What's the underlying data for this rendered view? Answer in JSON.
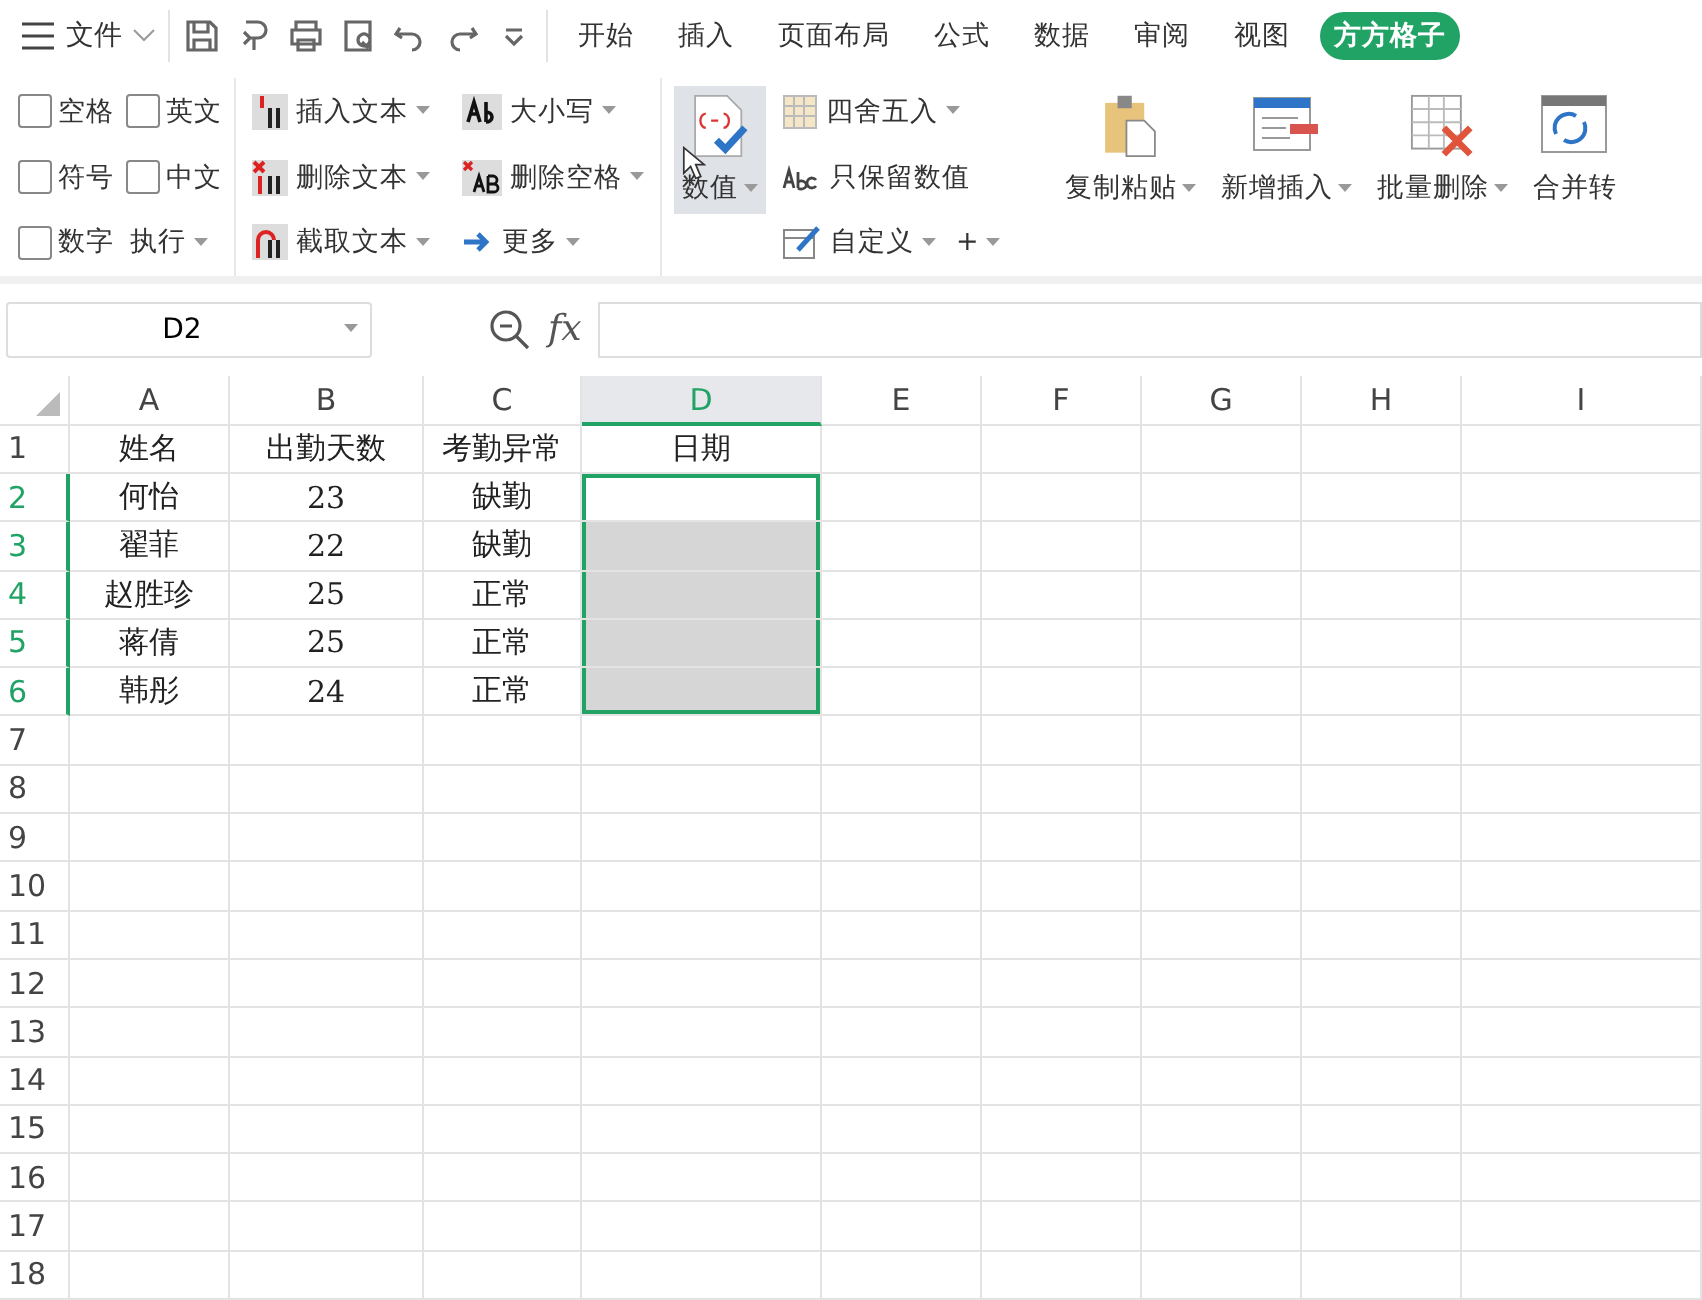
{
  "menu": {
    "label": "文件"
  },
  "tabs": [
    {
      "label": "开始",
      "selected": false
    },
    {
      "label": "插入",
      "selected": false
    },
    {
      "label": "页面布局",
      "selected": false
    },
    {
      "label": "公式",
      "selected": false
    },
    {
      "label": "数据",
      "selected": false
    },
    {
      "label": "审阅",
      "selected": false
    },
    {
      "label": "视图",
      "selected": false
    },
    {
      "label": "方方格子",
      "selected": true
    }
  ],
  "ribbon_groups": [
    {
      "kind": "small",
      "rows": [
        [
          {
            "kind": "checkbox",
            "label": "空格",
            "checked": false
          },
          {
            "kind": "checkbox",
            "label": "英文",
            "checked": false
          }
        ],
        [
          {
            "kind": "checkbox",
            "label": "符号",
            "checked": false
          },
          {
            "kind": "checkbox",
            "label": "中文",
            "checked": false
          }
        ],
        [
          {
            "kind": "checkbox",
            "label": "数字",
            "checked": false
          },
          {
            "kind": "button",
            "label": "执行",
            "dropdown": true
          }
        ]
      ]
    },
    {
      "kind": "small",
      "rows": [
        [
          {
            "kind": "button",
            "label": "插入文本",
            "dropdown": true
          }
        ],
        [
          {
            "kind": "button",
            "label": "删除文本",
            "dropdown": true
          }
        ],
        [
          {
            "kind": "button",
            "label": "截取文本",
            "dropdown": true
          }
        ]
      ]
    },
    {
      "kind": "small",
      "rows": [
        [
          {
            "kind": "button",
            "label": "大小写",
            "dropdown": true
          }
        ],
        [
          {
            "kind": "button",
            "label": "删除空格",
            "dropdown": true
          }
        ],
        [
          {
            "kind": "button",
            "label": "更多",
            "dropdown": true
          }
        ]
      ]
    },
    {
      "kind": "large",
      "items": [
        {
          "label": "数值",
          "dropdown": true,
          "hovered": true
        }
      ]
    },
    {
      "kind": "small",
      "rows": [
        [
          {
            "kind": "button",
            "label": "四舍五入",
            "dropdown": true
          }
        ],
        [
          {
            "kind": "button",
            "label": "只保留数值",
            "dropdown": false
          }
        ],
        [
          {
            "kind": "button",
            "label": "自定义",
            "dropdown": true
          },
          {
            "kind": "button",
            "label": "+",
            "dropdown": true
          }
        ]
      ]
    },
    {
      "kind": "large",
      "items": [
        {
          "label": "复制粘贴",
          "dropdown": true,
          "hovered": false
        },
        {
          "label": "新增插入",
          "dropdown": true,
          "hovered": false
        },
        {
          "label": "批量删除",
          "dropdown": true,
          "hovered": false
        },
        {
          "label": "合并转",
          "dropdown": false,
          "hovered": false
        }
      ]
    }
  ],
  "formula_bar": {
    "name_box": "D2",
    "fx_label": "fx"
  },
  "sheet": {
    "columns": [
      {
        "label": "A",
        "selected": false
      },
      {
        "label": "B",
        "selected": false
      },
      {
        "label": "C",
        "selected": false
      },
      {
        "label": "D",
        "selected": true
      },
      {
        "label": "E",
        "selected": false
      },
      {
        "label": "F",
        "selected": false
      },
      {
        "label": "G",
        "selected": false
      },
      {
        "label": "H",
        "selected": false
      },
      {
        "label": "I",
        "selected": false
      }
    ],
    "rows": [
      {
        "number": "1",
        "selected": false,
        "cells": [
          "姓名",
          "出勤天数",
          "考勤异常",
          "日期"
        ]
      },
      {
        "number": "2",
        "selected": true,
        "active": true,
        "cells": [
          "何怡",
          "23",
          "缺勤"
        ]
      },
      {
        "number": "3",
        "selected": true,
        "active": false,
        "cells": [
          "翟菲",
          "22",
          "缺勤"
        ]
      },
      {
        "number": "4",
        "selected": true,
        "active": false,
        "cells": [
          "赵胜珍",
          "25",
          "正常"
        ]
      },
      {
        "number": "5",
        "selected": true,
        "active": false,
        "cells": [
          "蒋倩",
          "25",
          "正常"
        ]
      },
      {
        "number": "6",
        "selected": true,
        "active": false,
        "cells": [
          "韩彤",
          "24",
          "正常"
        ]
      },
      {
        "number": "7",
        "selected": false,
        "cells": []
      },
      {
        "number": "8",
        "selected": false,
        "cells": []
      },
      {
        "number": "9",
        "selected": false,
        "cells": []
      },
      {
        "number": "10",
        "selected": false,
        "cells": []
      },
      {
        "number": "11",
        "selected": false,
        "cells": []
      },
      {
        "number": "12",
        "selected": false,
        "cells": []
      },
      {
        "number": "13",
        "selected": false,
        "cells": []
      },
      {
        "number": "14",
        "selected": false,
        "cells": []
      },
      {
        "number": "15",
        "selected": false,
        "cells": []
      },
      {
        "number": "16",
        "selected": false,
        "cells": []
      },
      {
        "number": "17",
        "selected": false,
        "cells": []
      },
      {
        "number": "18",
        "selected": false,
        "cells": []
      }
    ]
  }
}
